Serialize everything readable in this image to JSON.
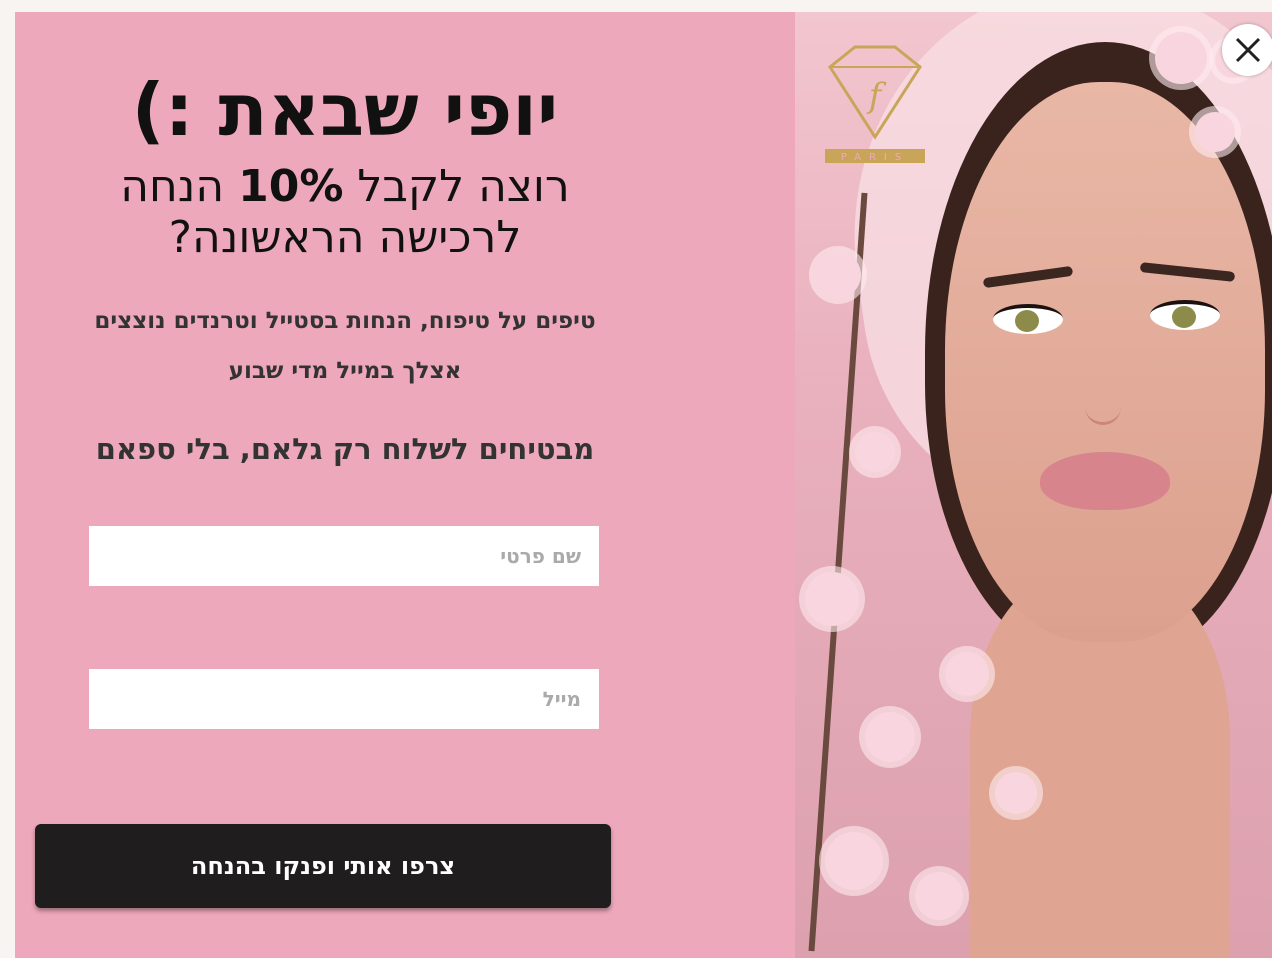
{
  "popup": {
    "headline": "יופי שבאת :)",
    "subhead_pre": "רוצה לקבל ",
    "subhead_bold": "10%",
    "subhead_post": " הנחה לרכישה הראשונה?",
    "description_line1": "טיפים על טיפוח, הנחות בסטייל וטרנדים נוצצים",
    "description_line2": "אצלך במייל מדי שבוע",
    "promise": "מבטיחים לשלוח רק גלאם, בלי ספאם",
    "name_field": {
      "placeholder": "שם פרטי",
      "value": ""
    },
    "email_field": {
      "placeholder": "מייל",
      "value": ""
    },
    "cta_label": "צרפו אותי ופנקו בהנחה",
    "logo_icon": "fv-diamond-logo-icon",
    "logo_caption": "PARIS",
    "close_icon": "close-icon"
  },
  "colors": {
    "background": "#eea8bc",
    "button": "#1f1d1e",
    "gold": "#c9a55a"
  }
}
